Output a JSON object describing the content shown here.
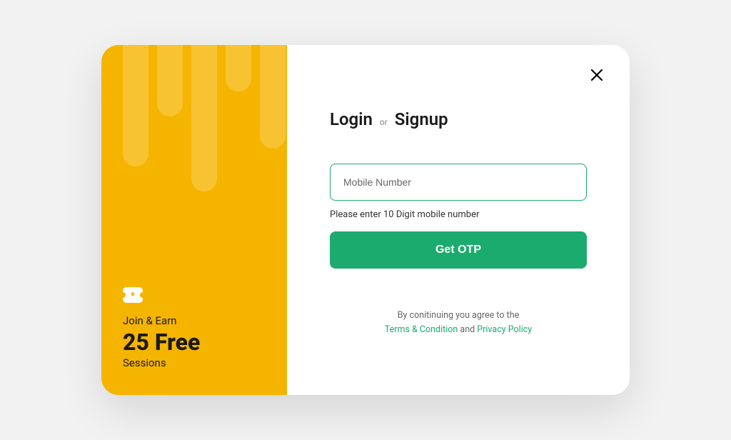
{
  "promo": {
    "join_label": "Join & Earn",
    "big_text": "25 Free",
    "sub_text": "Sessions"
  },
  "form": {
    "title_login": "Login",
    "title_or": "or",
    "title_signup": "Signup",
    "mobile_placeholder": "Mobile Number",
    "helper": "Please enter 10 Digit mobile number",
    "button": "Get OTP"
  },
  "footer": {
    "prefix": "By conitinuing you agree to the",
    "terms": "Terms & Condition",
    "and": " and ",
    "privacy": "Privacy Policy"
  },
  "colors": {
    "accent_yellow": "#F5B400",
    "accent_green": "#1CAB6E"
  }
}
